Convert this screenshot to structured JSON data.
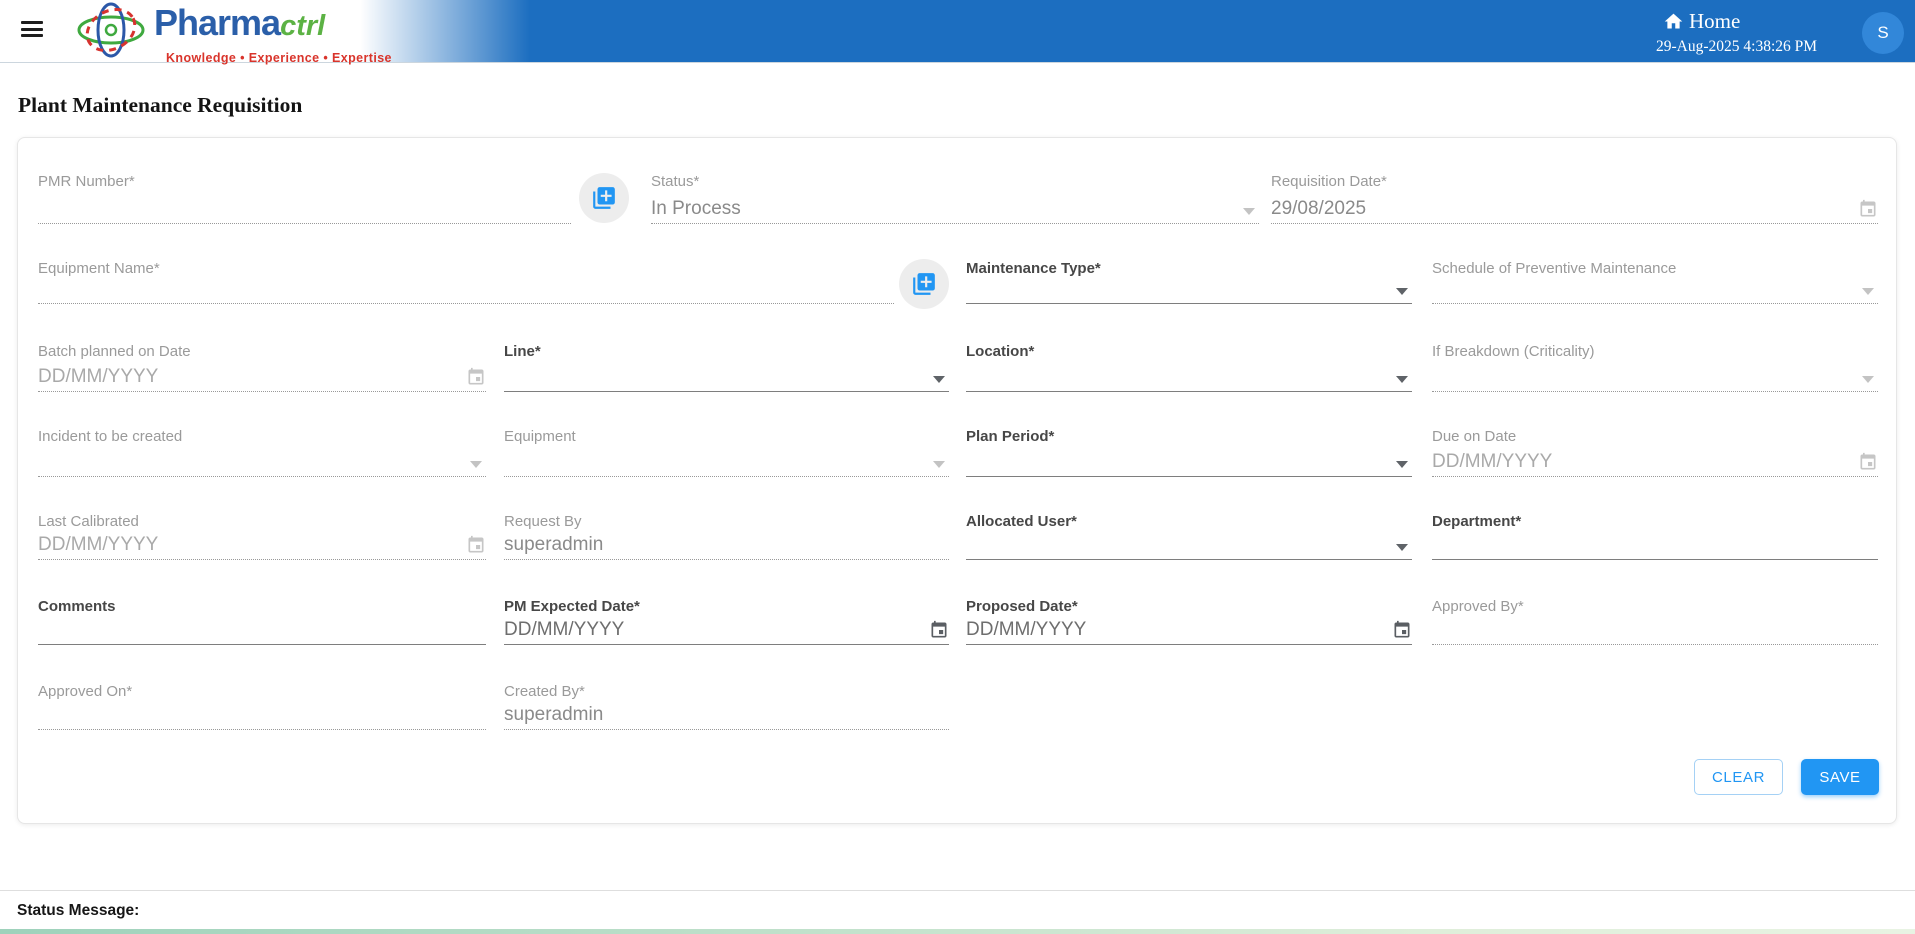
{
  "header": {
    "brand": {
      "name_primary": "Pharma",
      "name_secondary": "ctrl",
      "tagline": "Knowledge • Experience • Expertise"
    },
    "home_label": "Home",
    "datetime": "29-Aug-2025 4:38:26 PM",
    "avatar_initial": "S"
  },
  "page": {
    "title": "Plant Maintenance Requisition"
  },
  "form": {
    "fields": {
      "pmr_number": {
        "label": "PMR Number*",
        "value": "",
        "disabled": true
      },
      "status": {
        "label": "Status*",
        "value": "In Process",
        "type": "select",
        "disabled": true
      },
      "requisition_date": {
        "label": "Requisition Date*",
        "value": "29/08/2025",
        "type": "date",
        "disabled": true
      },
      "equipment_name": {
        "label": "Equipment Name*",
        "value": "",
        "disabled": true
      },
      "maintenance_type": {
        "label": "Maintenance Type*",
        "value": "",
        "type": "select",
        "disabled": false
      },
      "schedule_of_preventive_maintenance": {
        "label": "Schedule of Preventive Maintenance",
        "value": "",
        "type": "select",
        "disabled": true
      },
      "batch_planned_on_date": {
        "label": "Batch planned on Date",
        "value": "",
        "placeholder": "DD/MM/YYYY",
        "type": "date",
        "disabled": true
      },
      "line": {
        "label": "Line*",
        "value": "",
        "type": "select",
        "disabled": false
      },
      "location": {
        "label": "Location*",
        "value": "",
        "type": "select",
        "disabled": false
      },
      "if_breakdown_criticality": {
        "label": "If Breakdown (Criticality)",
        "value": "",
        "type": "select",
        "disabled": true
      },
      "incident_to_be_created": {
        "label": "Incident to be created",
        "value": "",
        "type": "select",
        "disabled": true
      },
      "equipment": {
        "label": "Equipment",
        "value": "",
        "type": "select",
        "disabled": true
      },
      "plan_period": {
        "label": "Plan Period*",
        "value": "",
        "type": "select",
        "disabled": false
      },
      "due_on_date": {
        "label": "Due on Date",
        "value": "",
        "placeholder": "DD/MM/YYYY",
        "type": "date",
        "disabled": true
      },
      "last_calibrated": {
        "label": "Last Calibrated",
        "value": "",
        "placeholder": "DD/MM/YYYY",
        "type": "date",
        "disabled": true
      },
      "request_by": {
        "label": "Request By",
        "value": "superadmin",
        "disabled": true
      },
      "allocated_user": {
        "label": "Allocated User*",
        "value": "",
        "type": "select",
        "disabled": false
      },
      "department": {
        "label": "Department*",
        "value": "",
        "disabled": false
      },
      "comments": {
        "label": "Comments",
        "value": "",
        "disabled": false
      },
      "pm_expected_date": {
        "label": "PM Expected Date*",
        "value": "",
        "placeholder": "DD/MM/YYYY",
        "type": "date",
        "disabled": false
      },
      "proposed_date": {
        "label": "Proposed Date*",
        "value": "",
        "placeholder": "DD/MM/YYYY",
        "type": "date",
        "disabled": false
      },
      "approved_by": {
        "label": "Approved By*",
        "value": "",
        "disabled": true
      },
      "approved_on": {
        "label": "Approved On*",
        "value": "",
        "disabled": true
      },
      "created_by": {
        "label": "Created By*",
        "value": "superadmin",
        "disabled": true
      }
    },
    "buttons": {
      "clear": "CLEAR",
      "save": "SAVE"
    }
  },
  "footer": {
    "status_message_label": "Status Message:"
  },
  "colors": {
    "header_blue": "#1c6ec0",
    "accent_blue": "#2196f3",
    "brand_blue": "#2b5fa9",
    "brand_green": "#5cb244",
    "tagline_red": "#d9342b",
    "strip_left": "#9ed2bb",
    "strip_right": "#e8f3e3"
  }
}
